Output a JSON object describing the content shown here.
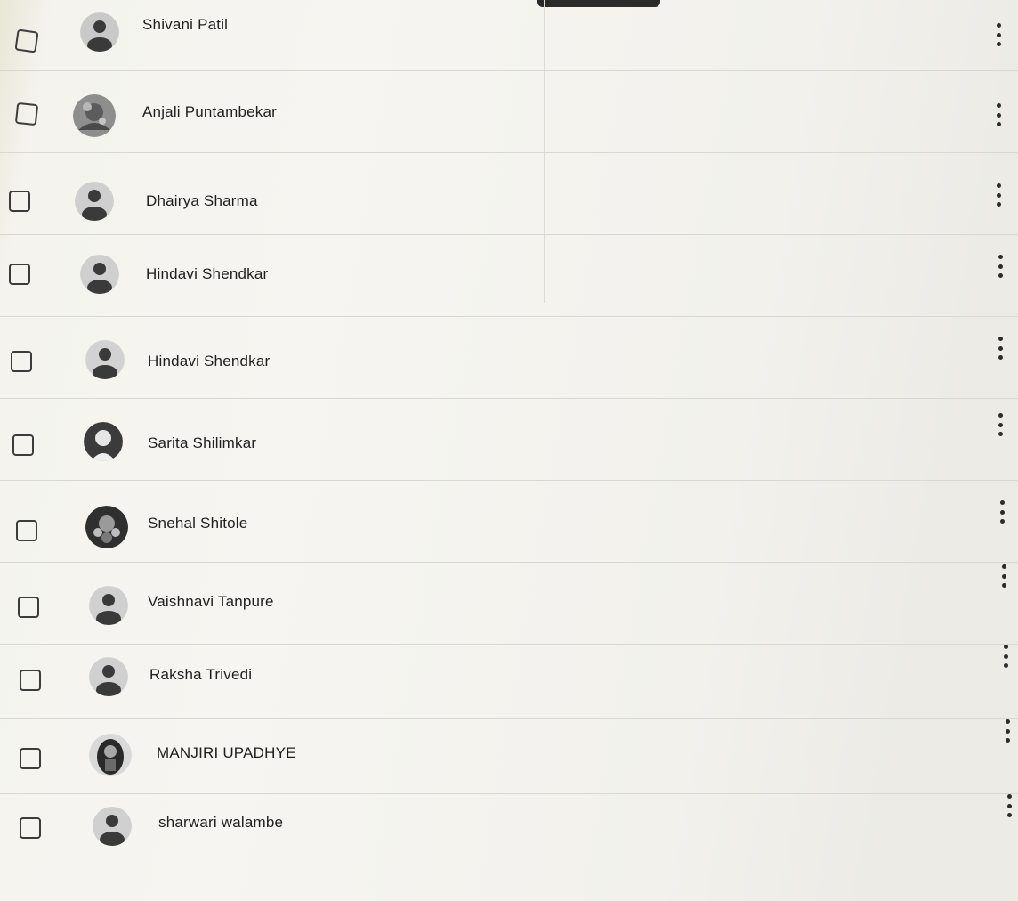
{
  "students": [
    {
      "name": "Shivani Patil",
      "avatar": "default-person-icon"
    },
    {
      "name": "Anjali Puntambekar",
      "avatar": "photo-avatar"
    },
    {
      "name": "Dhairya Sharma",
      "avatar": "default-person-icon"
    },
    {
      "name": "Hindavi Shendkar",
      "avatar": "default-person-icon"
    },
    {
      "name": "Hindavi Shendkar",
      "avatar": "default-person-icon"
    },
    {
      "name": "Sarita Shilimkar",
      "avatar": "photo-avatar"
    },
    {
      "name": "Snehal Shitole",
      "avatar": "photo-avatar"
    },
    {
      "name": "Vaishnavi Tanpure",
      "avatar": "default-person-icon"
    },
    {
      "name": "Raksha Trivedi",
      "avatar": "default-person-icon"
    },
    {
      "name": "MANJIRI UPADHYE",
      "avatar": "photo-avatar"
    },
    {
      "name": "sharwari walambe",
      "avatar": "default-person-icon"
    }
  ],
  "colors": {
    "text": "#1f1f1f",
    "icon": "#2b2b2b",
    "divider": "#d9d7d0"
  }
}
